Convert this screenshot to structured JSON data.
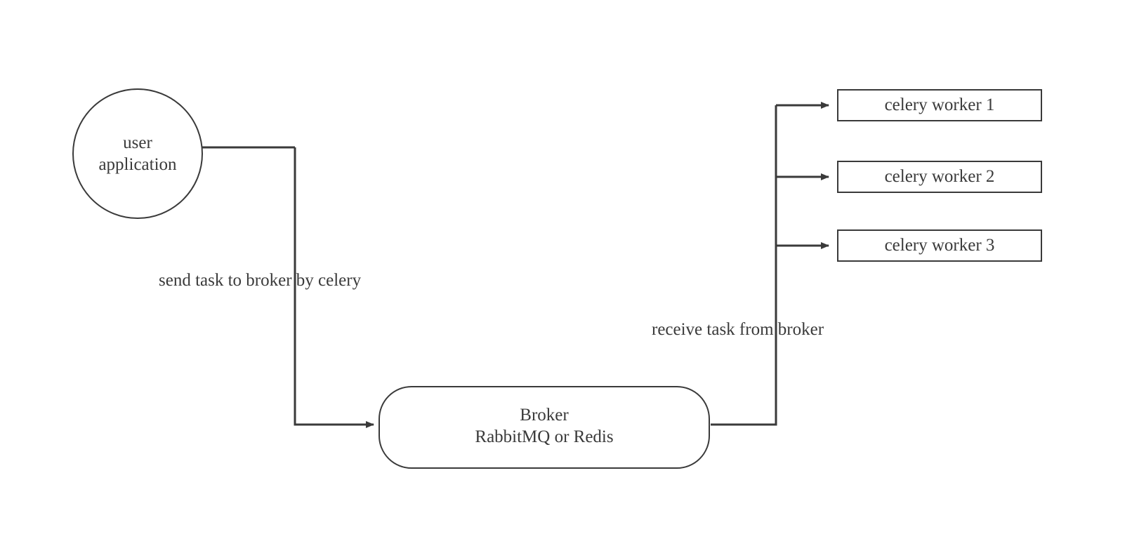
{
  "user_node": {
    "line1": "user",
    "line2": "application"
  },
  "broker_node": {
    "line1": "Broker",
    "line2": "RabbitMQ or Redis"
  },
  "workers": [
    "celery worker 1",
    "celery worker 2",
    "celery worker 3"
  ],
  "edge_send": "send task to broker by celery",
  "edge_receive": "receive task from broker"
}
